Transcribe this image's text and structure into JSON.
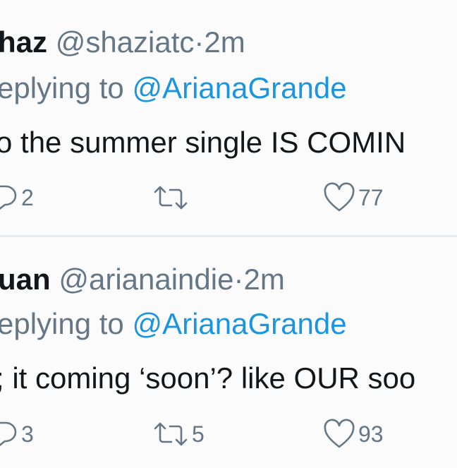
{
  "tweets": [
    {
      "name": "haz",
      "handle": "@shaziatc",
      "dot": "·",
      "time": "2m",
      "replying_prefix": "eplying to",
      "mention": "@ArianaGrande",
      "text": "o the summer single IS COMIN",
      "reply_count": "2",
      "retweet_count": "",
      "like_count": "77"
    },
    {
      "name": "uan",
      "handle": "@arianaindie",
      "dot": "·",
      "time": "2m",
      "replying_prefix": "eplying to",
      "mention": "@ArianaGrande",
      "text": "; it coming ‘soon’? like OUR soo",
      "reply_count": "3",
      "retweet_count": "5",
      "like_count": "93"
    }
  ],
  "icons": [
    "reply-icon",
    "retweet-icon",
    "like-icon"
  ],
  "colors": {
    "link": "#1b95e0",
    "secondary_text": "#657786",
    "primary_text": "#14171a",
    "divider": "#e6ecf0",
    "background": "#fbfbfb"
  }
}
